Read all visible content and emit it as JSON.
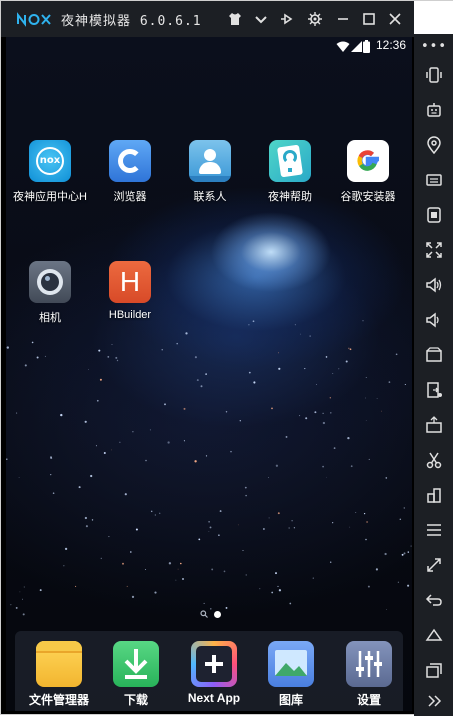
{
  "window": {
    "brand": "nox",
    "title": "夜神模拟器 6.0.6.1",
    "controls": [
      "shirt-icon",
      "chevron-down-icon",
      "pin-icon",
      "settings-icon",
      "minimize-icon",
      "maximize-icon",
      "close-icon"
    ]
  },
  "sidebar": {
    "more_label": "•••",
    "items": [
      "shake-icon",
      "robot-icon",
      "location-icon",
      "keyboard-icon",
      "screenshot-icon",
      "fullscreen-icon",
      "volume-up-icon",
      "volume-down-icon",
      "record-icon",
      "multi-instance-icon",
      "apk-install-icon",
      "scissors-icon",
      "building-icon",
      "menu-icon",
      "resize-icon",
      "back-icon",
      "home-icon",
      "recents-icon",
      "expand-icon"
    ]
  },
  "status_bar": {
    "time": "12:36"
  },
  "apps": [
    {
      "label": "夜神应用中心H",
      "icon": "nox-app-center-icon",
      "color": "#1aa6e8"
    },
    {
      "label": "浏览器",
      "icon": "browser-icon",
      "color": "#3a8ee6"
    },
    {
      "label": "联系人",
      "icon": "contacts-icon",
      "color": "#4aa3df"
    },
    {
      "label": "夜神帮助",
      "icon": "nox-help-icon",
      "color": "#35c2b6"
    },
    {
      "label": "谷歌安装器",
      "icon": "google-installer-icon",
      "color": "#ffffff"
    },
    {
      "label": "相机",
      "icon": "camera-icon",
      "color": "#5a6474"
    },
    {
      "label": "HBuilder",
      "icon": "hbuilder-icon",
      "color": "#e0522f"
    }
  ],
  "dock": [
    {
      "label": "文件管理器",
      "icon": "file-manager-icon",
      "color": "#f6c343"
    },
    {
      "label": "下载",
      "icon": "download-icon",
      "color": "#3ec46d"
    },
    {
      "label": "Next App",
      "icon": "next-app-icon",
      "color": "#7b5cd6"
    },
    {
      "label": "图库",
      "icon": "gallery-icon",
      "color": "#5b8fe8"
    },
    {
      "label": "设置",
      "icon": "settings-app-icon",
      "color": "#6f7fa8"
    }
  ],
  "hbuilder_glyph": "H"
}
